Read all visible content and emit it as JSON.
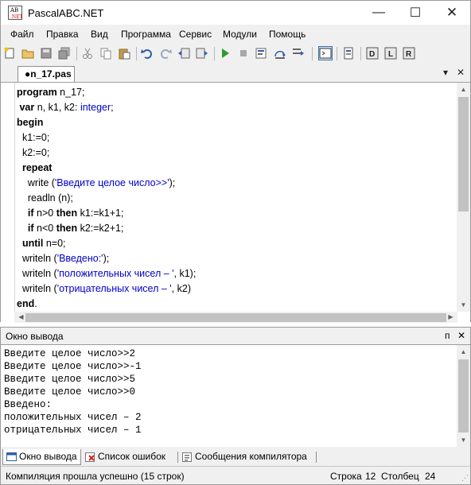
{
  "window": {
    "title": "PascalABC.NET",
    "minimize_glyph": "—",
    "maximize_glyph": "☐",
    "close_glyph": "✕"
  },
  "menu": [
    "Файл",
    "Правка",
    "Вид",
    "Программа",
    "Сервис",
    "Модули",
    "Помощь"
  ],
  "toolbar": {
    "icons": [
      "new-file-icon",
      "open-folder-icon",
      "save-icon",
      "save-all-icon",
      "cut-icon",
      "copy-icon",
      "paste-icon",
      "undo-icon",
      "redo-icon",
      "step-back-icon",
      "step-forward-icon",
      "run-icon",
      "stop-icon",
      "debug-step-icon",
      "debug-step-over-icon",
      "output-window-icon",
      "settings-icon",
      "module-d-icon",
      "module-l-icon",
      "module-r-icon"
    ],
    "accent": "#2f9a2f"
  },
  "editor": {
    "tab_label": "●n_17.pas",
    "tab_dropdown_glyph": "▾",
    "tab_close_glyph": "✕",
    "lines": [
      [
        {
          "t": "program",
          "k": "kw"
        },
        {
          "t": " n_17;",
          "k": ""
        }
      ],
      [
        {
          "t": " ",
          "k": ""
        },
        {
          "t": "var",
          "k": "kw"
        },
        {
          "t": " n, k1, k2: ",
          "k": ""
        },
        {
          "t": "integer",
          "k": "ty"
        },
        {
          "t": ";",
          "k": ""
        }
      ],
      [
        {
          "t": "begin",
          "k": "kw"
        }
      ],
      [
        {
          "t": "  k1:=0;",
          "k": ""
        }
      ],
      [
        {
          "t": "  k2:=0;",
          "k": ""
        }
      ],
      [
        {
          "t": "  ",
          "k": ""
        },
        {
          "t": "repeat",
          "k": "kw"
        }
      ],
      [
        {
          "t": "    write (",
          "k": ""
        },
        {
          "t": "'Введите целое число>>'",
          "k": "str"
        },
        {
          "t": ");",
          "k": ""
        }
      ],
      [
        {
          "t": "    readln (n);",
          "k": ""
        }
      ],
      [
        {
          "t": "    ",
          "k": ""
        },
        {
          "t": "if",
          "k": "kw"
        },
        {
          "t": " n>0 ",
          "k": ""
        },
        {
          "t": "then",
          "k": "kw"
        },
        {
          "t": " k1:=k1+1;",
          "k": ""
        }
      ],
      [
        {
          "t": "    ",
          "k": ""
        },
        {
          "t": "if",
          "k": "kw"
        },
        {
          "t": " n<0 ",
          "k": ""
        },
        {
          "t": "then",
          "k": "kw"
        },
        {
          "t": " k2:=k2+1;",
          "k": ""
        }
      ],
      [
        {
          "t": "  ",
          "k": ""
        },
        {
          "t": "until",
          "k": "kw"
        },
        {
          "t": " n=0;",
          "k": ""
        }
      ],
      [
        {
          "t": "  writeln (",
          "k": ""
        },
        {
          "t": "'Введено:'",
          "k": "str"
        },
        {
          "t": ");",
          "k": ""
        }
      ],
      [
        {
          "t": "  writeln (",
          "k": ""
        },
        {
          "t": "'положительных чисел – '",
          "k": "str"
        },
        {
          "t": ", k1);",
          "k": ""
        }
      ],
      [
        {
          "t": "  writeln (",
          "k": ""
        },
        {
          "t": "'отрицательных чисел – '",
          "k": "str"
        },
        {
          "t": ", k2)",
          "k": ""
        }
      ],
      [
        {
          "t": "end",
          "k": "kw"
        },
        {
          "t": ".",
          "k": ""
        }
      ]
    ]
  },
  "output": {
    "title": "Окно вывода",
    "pin_glyph": "ᴨ",
    "close_glyph": "✕",
    "lines": [
      "Введите целое число>>2",
      "Введите целое число>>-1",
      "Введите целое число>>5",
      "Введите целое число>>0",
      "Введено:",
      "положительных чисел – 2",
      "отрицательных чисел – 1"
    ]
  },
  "bottom_tabs": [
    "Окно вывода",
    "Список ошибок",
    "Сообщения компилятора"
  ],
  "status": {
    "message": "Компиляция прошла успешно (15 строк)",
    "line_label": "Строка",
    "line_value": "12",
    "col_label": "Столбец",
    "col_value": "24"
  }
}
